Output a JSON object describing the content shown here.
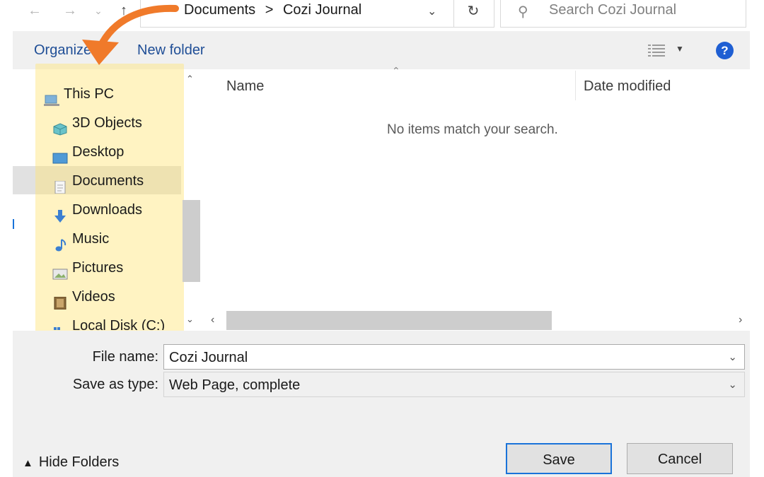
{
  "address": {
    "breadcrumb": [
      "Documents",
      "Cozi Journal"
    ],
    "separator": ">",
    "search_placeholder": "Search Cozi Journal"
  },
  "toolbar": {
    "organize_label": "Organize",
    "new_folder_label": "New folder"
  },
  "nav": {
    "items": [
      {
        "label": "This PC",
        "icon": "computer-icon"
      },
      {
        "label": "3D Objects",
        "icon": "cube-icon"
      },
      {
        "label": "Desktop",
        "icon": "desktop-icon"
      },
      {
        "label": "Documents",
        "icon": "document-icon",
        "selected": true
      },
      {
        "label": "Downloads",
        "icon": "download-arrow-icon"
      },
      {
        "label": "Music",
        "icon": "music-note-icon"
      },
      {
        "label": "Pictures",
        "icon": "picture-icon"
      },
      {
        "label": "Videos",
        "icon": "film-icon"
      },
      {
        "label": "Local Disk (C:)",
        "icon": "disk-icon"
      }
    ]
  },
  "list": {
    "columns": [
      "Name",
      "Date modified"
    ],
    "empty_message": "No items match your search."
  },
  "form": {
    "file_name_label": "File name:",
    "file_name_value": "Cozi Journal",
    "save_type_label": "Save as type:",
    "save_type_value": "Web Page, complete"
  },
  "footer": {
    "hide_folders_label": "Hide Folders",
    "save_label": "Save",
    "cancel_label": "Cancel"
  },
  "colors": {
    "accent": "#1a73d9",
    "annotation_arrow": "#f07a2a",
    "highlight": "#ffe578"
  }
}
